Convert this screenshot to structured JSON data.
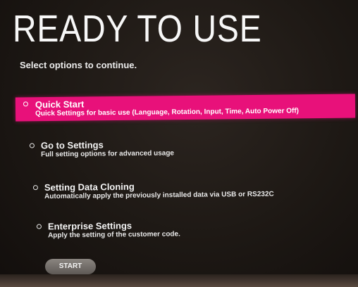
{
  "screen": {
    "title": "READY TO USE",
    "subtitle": "Select options to continue."
  },
  "options": [
    {
      "label": "Quick Start",
      "description": "Quick Settings for basic use (Language, Rotation, Input, Time, Auto Power Off)",
      "selected": true
    },
    {
      "label": "Go to Settings",
      "description": "Full setting options for advanced usage",
      "selected": false
    },
    {
      "label": "Setting Data Cloning",
      "description": "Automatically apply the previously installed data via USB or RS232C",
      "selected": false
    },
    {
      "label": "Enterprise Settings",
      "description": "Apply the setting of the customer code.",
      "selected": false
    }
  ],
  "start_button": {
    "label": "START"
  },
  "colors": {
    "highlight": "#e8117a",
    "background": "#1d1814",
    "button": "#6e6965"
  }
}
